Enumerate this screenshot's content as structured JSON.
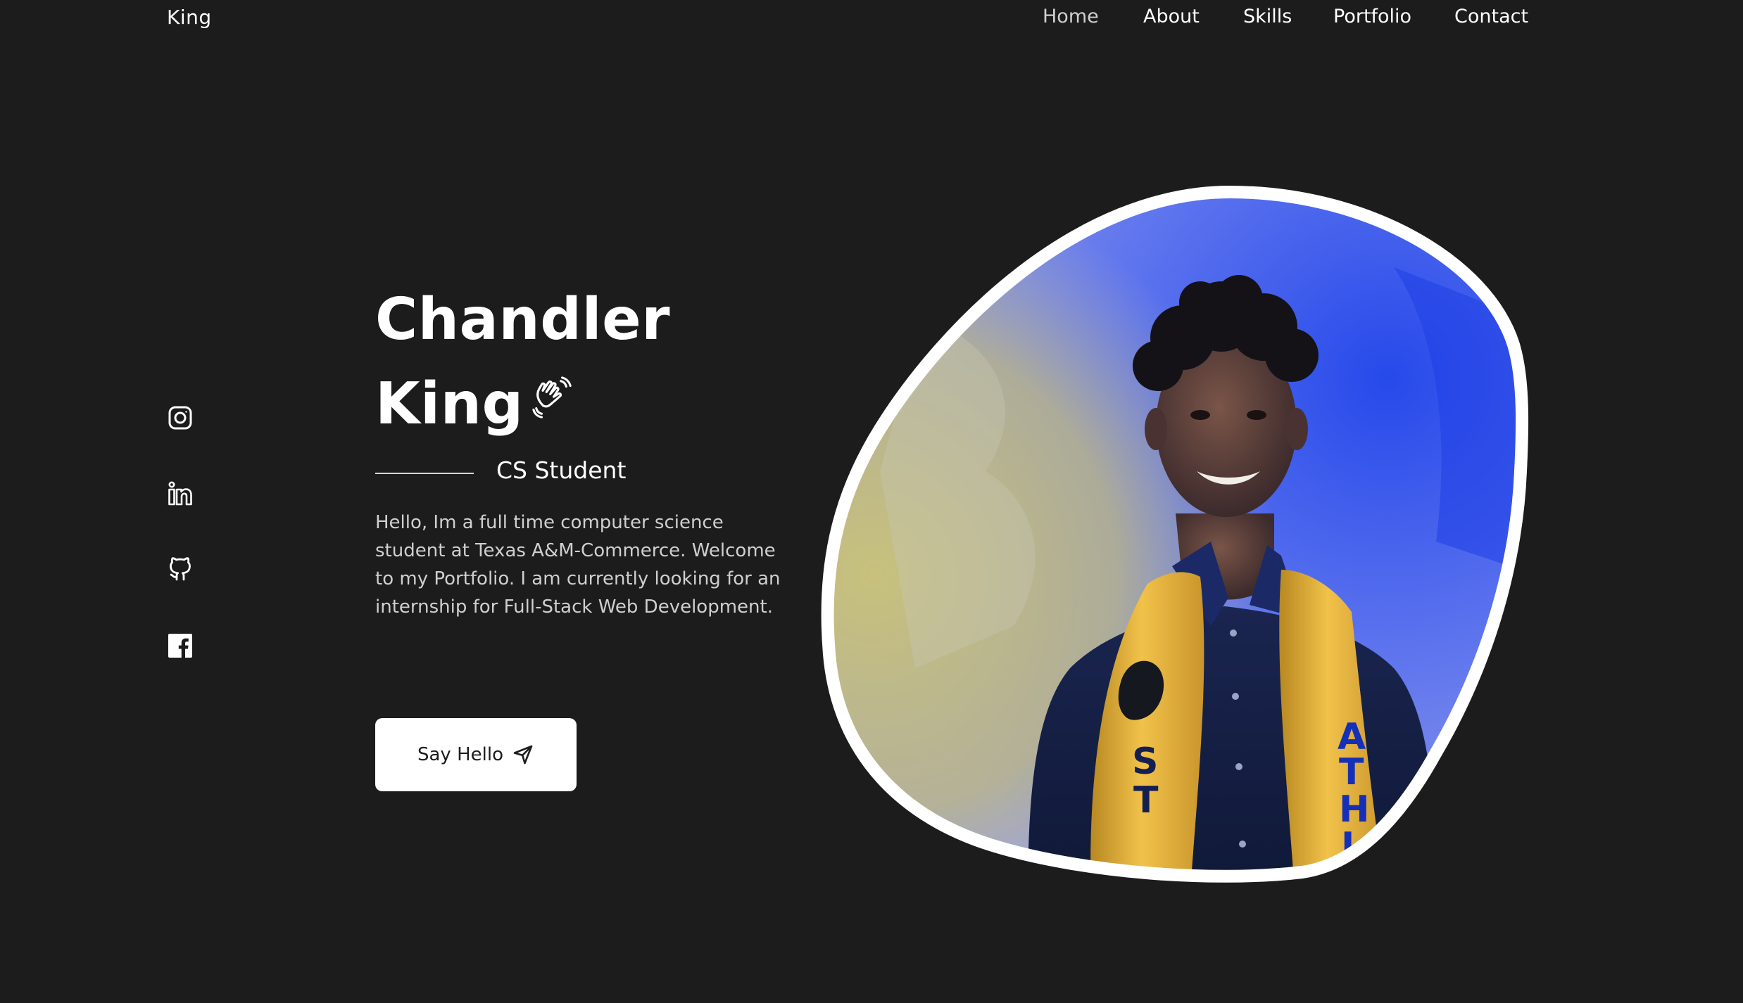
{
  "header": {
    "logo": "King",
    "nav": [
      {
        "label": "Home",
        "active": true
      },
      {
        "label": "About"
      },
      {
        "label": "Skills"
      },
      {
        "label": "Portfolio"
      },
      {
        "label": "Contact"
      }
    ]
  },
  "social": [
    {
      "icon": "instagram-icon"
    },
    {
      "icon": "linkedin-icon"
    },
    {
      "icon": "github-icon"
    },
    {
      "icon": "facebook-icon"
    }
  ],
  "hero": {
    "name_line1": "Chandler",
    "name_line2": "King",
    "wave_icon": "waving-hand-icon",
    "subtitle": "CS Student",
    "description": "Hello, Im a full time computer science student at Texas A&M-Commerce. Welcome to my Portfolio. I am currently looking for an internship for Full-Stack Web Development.",
    "cta_label": "Say Hello",
    "cta_icon": "send-icon"
  },
  "portrait": {
    "stole_left_text": "ST",
    "stole_right_text": "ATHL"
  },
  "colors": {
    "background": "#1c1c1c",
    "text": "#ffffff",
    "muted_text": "#cfcfcf",
    "button_bg": "#ffffff",
    "button_text": "#1c1c1c",
    "photo_bg_blue": "#3a55e6",
    "photo_bg_yellow": "#c9c07a",
    "stole_gold": "#e9b640"
  }
}
